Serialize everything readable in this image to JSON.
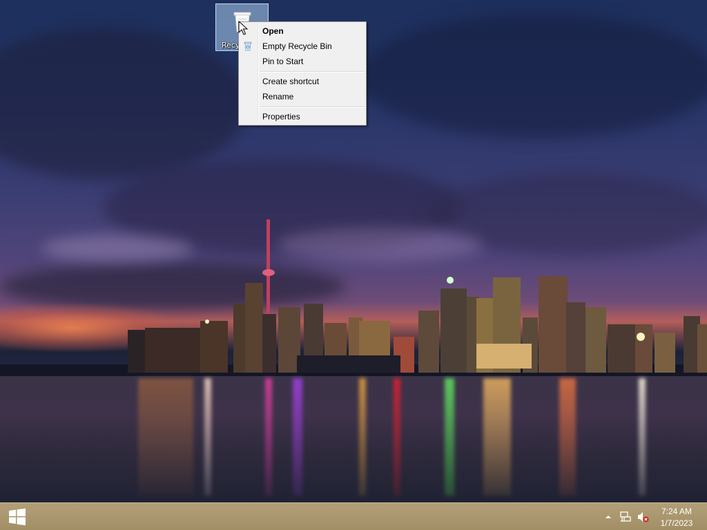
{
  "desktop": {
    "icons": [
      {
        "label": "Recycle Bin",
        "icon": "recycle-bin-icon"
      }
    ]
  },
  "context_menu": {
    "items": [
      {
        "label": "Open",
        "bold": true
      },
      {
        "label": "Empty Recycle Bin",
        "icon": "recycle-bin-icon"
      },
      {
        "label": "Pin to Start"
      },
      {
        "separator": true
      },
      {
        "label": "Create shortcut"
      },
      {
        "label": "Rename"
      },
      {
        "separator": true
      },
      {
        "label": "Properties"
      }
    ]
  },
  "taskbar": {
    "start_icon": "windows-logo-icon",
    "tray_icons": [
      "show-hidden-icons-chevron-icon",
      "network-icon",
      "speaker-muted-icon"
    ],
    "clock": {
      "time": "7:24 AM",
      "date": "1/7/2023"
    }
  },
  "colors": {
    "taskbar": "#a8956c",
    "menu_background": "#f0f0f0",
    "icon_selection": "#add0ee"
  }
}
